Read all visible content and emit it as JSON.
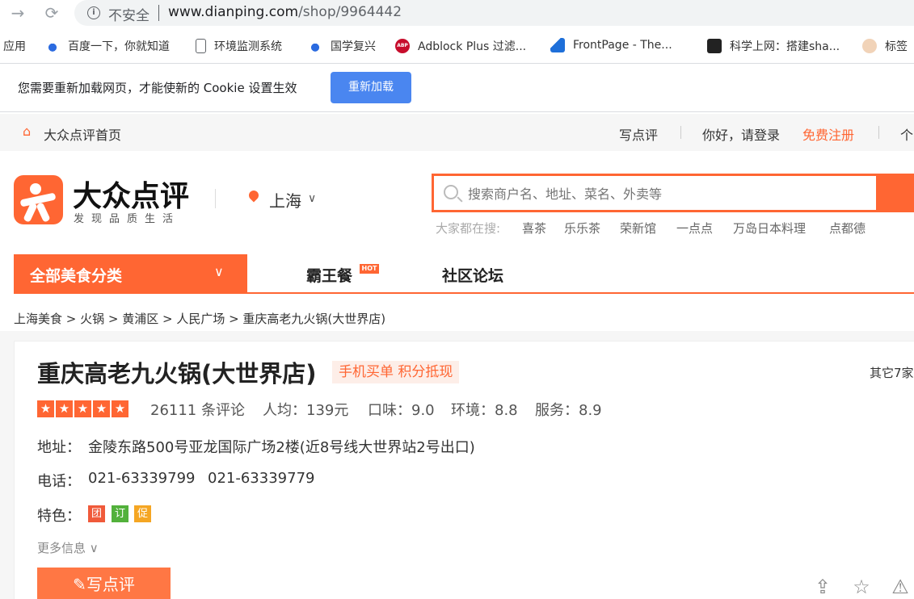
{
  "browser": {
    "insecure_label": "不安全",
    "url_host": "www.dianping.com",
    "url_path": "/shop/9964442",
    "bookmarks": [
      "应用",
      "百度一下，你就知道",
      "环境监测系统",
      "国学复兴",
      "Adblock Plus 过滤...",
      "FrontPage - The...",
      "科学上网：搭建sha...",
      "标签"
    ],
    "infobar_text": "您需要重新加载网页，才能使新的 Cookie 设置生效",
    "reload_label": "重新加载"
  },
  "topbar": {
    "home": "大众点评首页",
    "write_review": "写点评",
    "login": "你好，请登录",
    "register": "免费注册",
    "personal": "个"
  },
  "header": {
    "logo_name": "大众点评",
    "slogan": "发现品质生活",
    "city": "上海",
    "search_placeholder": "搜索商户名、地址、菜名、外卖等",
    "hot_label": "大家都在搜:",
    "hot_items": [
      "喜茶",
      "乐乐茶",
      "荣新馆",
      "一点点",
      "万岛日本料理",
      "点都德"
    ]
  },
  "nav": {
    "category": "全部美食分类",
    "items": [
      "霸王餐",
      "社区论坛"
    ],
    "hot_badge": "HOT"
  },
  "breadcrumb": "上海美食 > 火锅 > 黄浦区 > 人民广场 > 重庆高老九火锅(大世界店)",
  "shop": {
    "name": "重庆高老九火锅(大世界店)",
    "tag": "手机买单 积分抵现",
    "others": "其它7家",
    "rating_stars": 5,
    "reviews": "26111 条评论",
    "avg_price": "人均：139元",
    "taste": "口味：9.0",
    "environment": "环境：8.8",
    "service": "服务：8.9",
    "address_label": "地址：",
    "address": "金陵东路500号亚龙国际广场2楼(近8号线大世界站2号出口)",
    "phone_label": "电话：",
    "phones": [
      "021-63339799",
      "021-63339779"
    ],
    "features_label": "特色：",
    "features": [
      {
        "text": "团",
        "color": "#f05a3a"
      },
      {
        "text": "订",
        "color": "#52b13b"
      },
      {
        "text": "促",
        "color": "#f5a623"
      }
    ],
    "more_info": "更多信息",
    "write_review": "写点评"
  }
}
